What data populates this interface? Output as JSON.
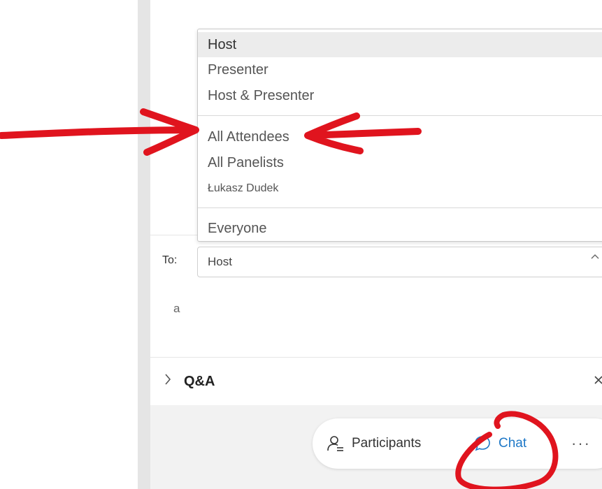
{
  "dropdown": {
    "options": [
      {
        "label": "Host",
        "selected": true
      },
      {
        "label": "Presenter"
      },
      {
        "label": "Host & Presenter"
      },
      {
        "label": "All Attendees"
      },
      {
        "label": "All Panelists"
      },
      {
        "label": "Łukasz Dudek"
      },
      {
        "label": "Everyone"
      }
    ]
  },
  "to_field": {
    "label": "To:",
    "value": "Host"
  },
  "message": {
    "text": "a"
  },
  "qa": {
    "label": "Q&A"
  },
  "toolbar": {
    "participants_label": "Participants",
    "chat_label": "Chat",
    "more_label": "···"
  },
  "colors": {
    "accent": "#1e78c7",
    "annotation": "#e0141e"
  },
  "icons": [
    "chevron-up-icon",
    "chevron-right-icon",
    "close-icon",
    "participants-icon",
    "chat-bubble-icon",
    "more-icon"
  ]
}
